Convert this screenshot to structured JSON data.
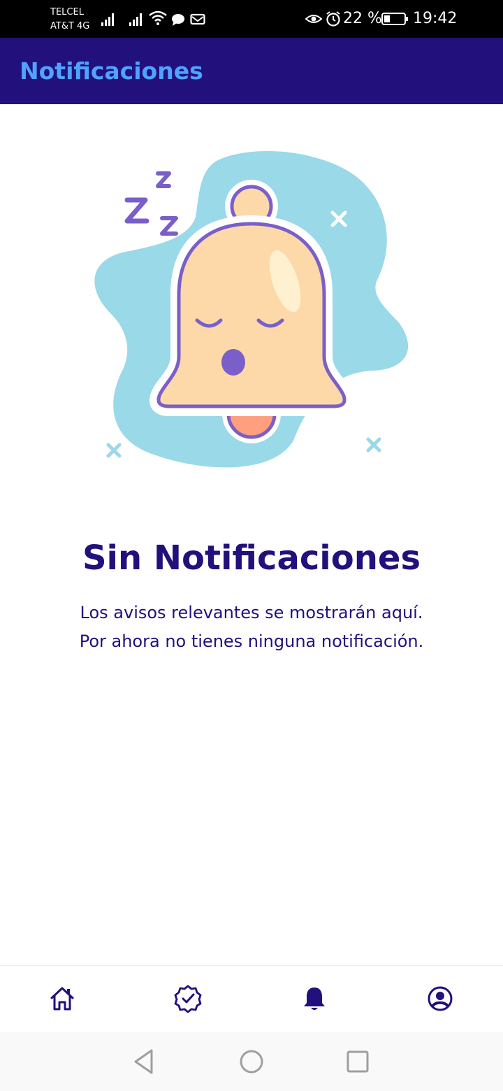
{
  "status_bar": {
    "carrier_line1": "TELCEL",
    "carrier_line2": "AT&T 4G",
    "battery": "22 %",
    "time": "19:42",
    "icons": [
      "signal-icon",
      "signal-icon",
      "wifi-icon",
      "chat-icon",
      "mail-icon",
      "eye-icon",
      "alarm-icon",
      "battery-icon"
    ]
  },
  "header": {
    "title": "Notificaciones"
  },
  "empty_state": {
    "title": "Sin Notificaciones",
    "line1": "Los avisos relevantes se mostrarán aquí.",
    "line2": "Por ahora no tienes ninguna notificación.",
    "illustration": "sleeping-bell-icon"
  },
  "bottom_nav": {
    "items": [
      {
        "icon": "home-icon",
        "active": false
      },
      {
        "icon": "verified-badge-icon",
        "active": false
      },
      {
        "icon": "bell-icon",
        "active": true
      },
      {
        "icon": "account-icon",
        "active": false
      }
    ]
  },
  "system_nav": {
    "items": [
      "back-icon",
      "home-circle-icon",
      "recents-icon"
    ]
  },
  "colors": {
    "primary": "#22107c",
    "title_accent": "#4fa3ff",
    "blob": "#99d9e8",
    "bell_fill": "#fdd9a9",
    "bell_outline": "#7a5fc9",
    "clapper": "#ff9f7e"
  }
}
